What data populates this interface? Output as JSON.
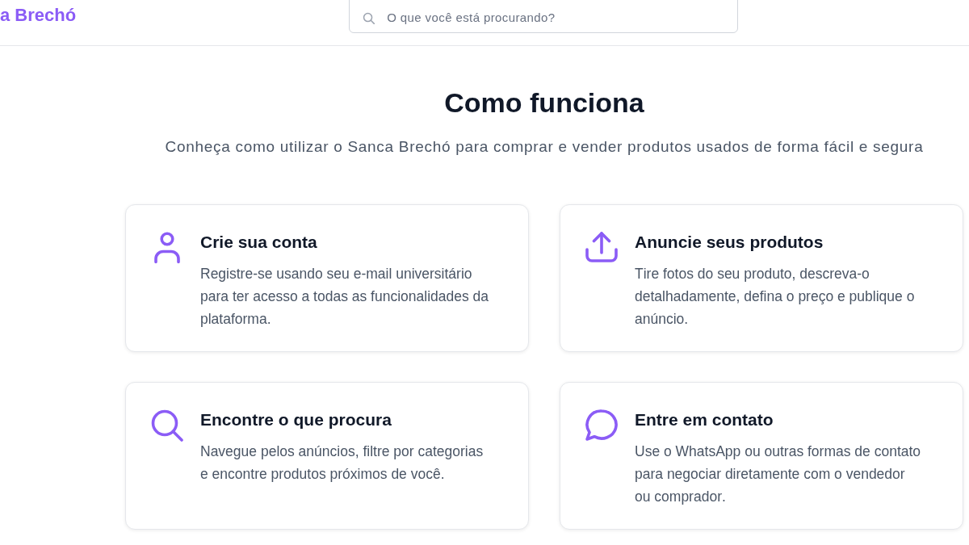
{
  "header": {
    "logo": "a Brechó",
    "search": {
      "placeholder": "O que você está procurando?"
    }
  },
  "section": {
    "title": "Como funciona",
    "subtitle": "Conheça como utilizar o Sanca Brechó para comprar e vender produtos usados de forma fácil e segura",
    "steps": [
      {
        "kind": "user",
        "title": "Crie sua conta",
        "description": "Registre-se usando seu e-mail universitário para ter acesso a todas as funcionalidades da plataforma."
      },
      {
        "kind": "upload",
        "title": "Anuncie seus produtos",
        "description": "Tire fotos do seu produto, descreva-o detalhadamente, defina o preço e publique o anúncio."
      },
      {
        "kind": "search",
        "title": "Encontre o que procura",
        "description": "Navegue pelos anúncios, filtre por categorias e encontre produtos próximos de você."
      },
      {
        "kind": "chat",
        "title": "Entre em contato",
        "description": "Use o WhatsApp ou outras formas de contato para negociar diretamente com o vendedor ou comprador."
      }
    ]
  }
}
